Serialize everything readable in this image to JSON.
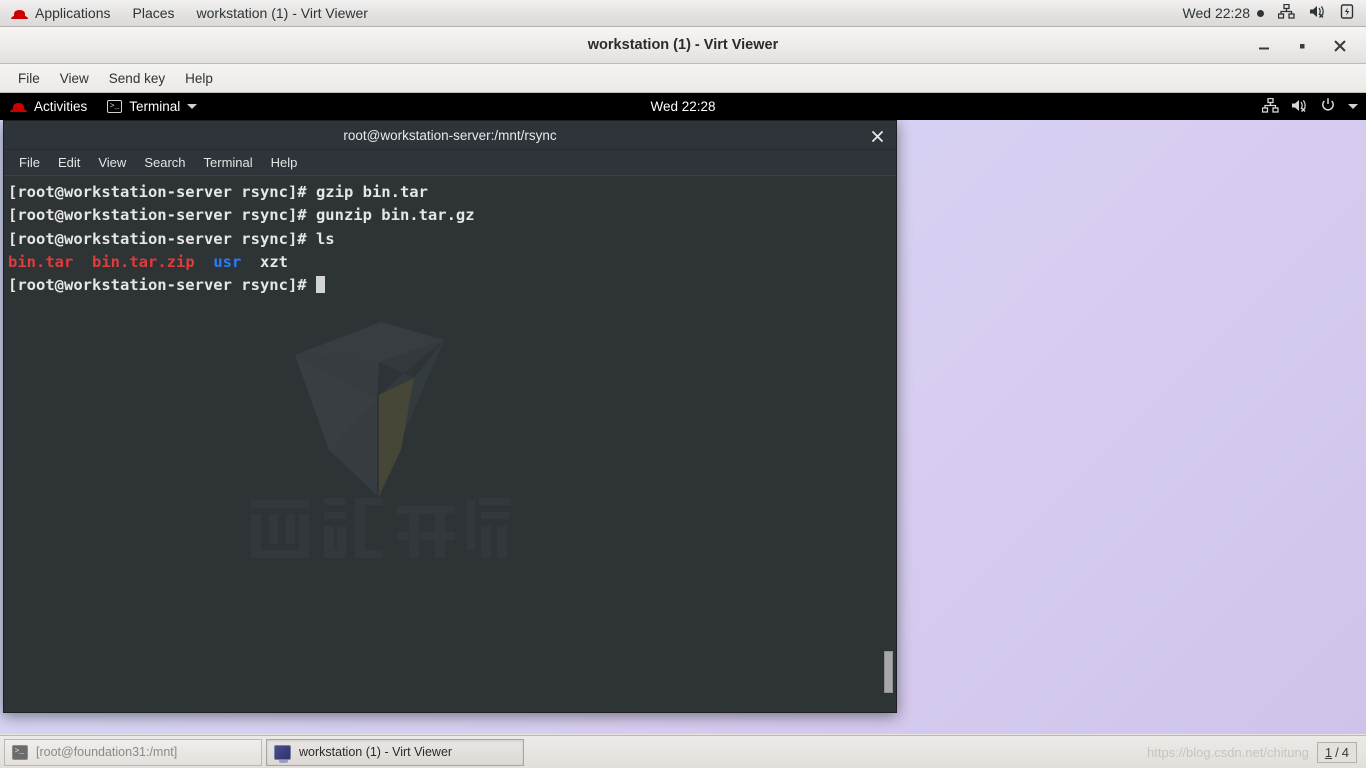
{
  "host_panel": {
    "logo_name": "red-hat-logo",
    "applications_label": "Applications",
    "places_label": "Places",
    "window_label": "workstation (1) - Virt Viewer",
    "clock": "Wed 22:28",
    "icons": [
      "network-wired-icon",
      "volume-muted-icon",
      "battery-icon"
    ]
  },
  "virt_viewer": {
    "title": "workstation (1) - Virt Viewer",
    "window_buttons": {
      "minimize": "minimize-button",
      "maximize": "maximize-button",
      "close": "close-button"
    },
    "menu": [
      "File",
      "View",
      "Send key",
      "Help"
    ]
  },
  "guest_topbar": {
    "activities_label": "Activities",
    "app_label": "Terminal",
    "clock": "Wed 22:28",
    "icons": [
      "network-wired-icon",
      "volume-muted-icon",
      "power-icon",
      "chevron-down-icon"
    ]
  },
  "terminal": {
    "title": "root@workstation-server:/mnt/rsync",
    "menu": [
      "File",
      "Edit",
      "View",
      "Search",
      "Terminal",
      "Help"
    ],
    "prompt": "[root@workstation-server rsync]# ",
    "lines": [
      {
        "type": "command",
        "prompt": "[root@workstation-server rsync]# ",
        "command": "gzip bin.tar"
      },
      {
        "type": "command",
        "prompt": "[root@workstation-server rsync]# ",
        "command": "gunzip bin.tar.gz"
      },
      {
        "type": "command",
        "prompt": "[root@workstation-server rsync]# ",
        "command": "ls"
      },
      {
        "type": "output",
        "items": [
          {
            "text": "bin.tar",
            "color": "red"
          },
          {
            "text": "bin.tar.zip",
            "color": "red"
          },
          {
            "text": "usr",
            "color": "blue"
          },
          {
            "text": "xzt",
            "color": "white"
          }
        ]
      },
      {
        "type": "prompt_only",
        "prompt": "[root@workstation-server rsync]# "
      }
    ],
    "colors": {
      "background": "#2e3436",
      "foreground": "#e6e6e6",
      "red": "#e03c3c",
      "blue": "#2a7bff"
    },
    "watermark_logo_text": "西部开源"
  },
  "taskbar": {
    "items": [
      {
        "label": "[root@foundation31:/mnt]",
        "icon": "terminal-icon",
        "active": false
      },
      {
        "label": "workstation (1) - Virt Viewer",
        "icon": "display-icon",
        "active": true
      }
    ],
    "watermark": "https://blog.csdn.net/chitung",
    "pager": {
      "current": "1",
      "separator": "/",
      "total": "4"
    }
  }
}
